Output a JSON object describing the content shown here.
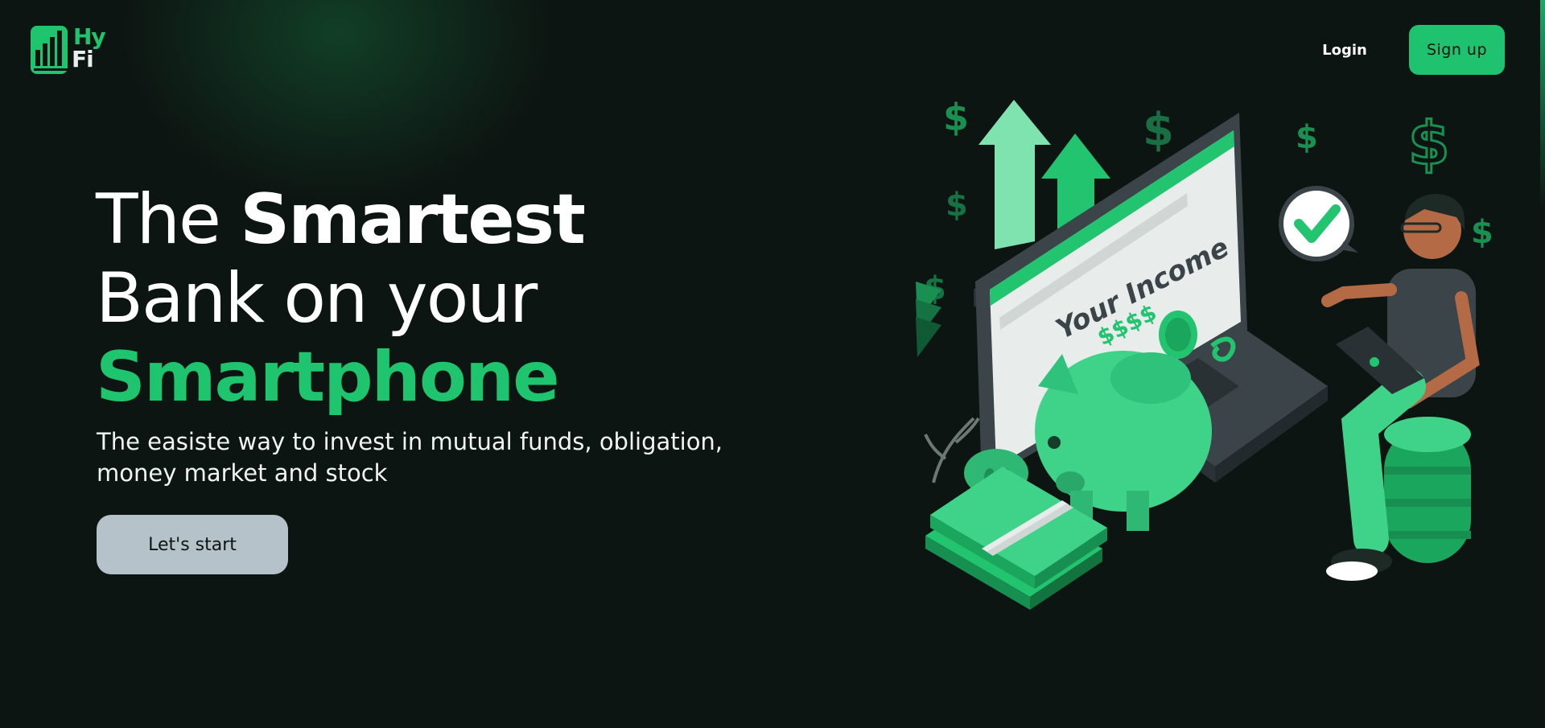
{
  "brand": {
    "logo_top": "Hy",
    "logo_bottom": "Fi",
    "primary_color": "#1ec26f",
    "logo_icon": "bar-chart-icon"
  },
  "nav": {
    "login_label": "Login",
    "signup_label": "Sign up"
  },
  "hero": {
    "title_word_1": "The",
    "title_word_2": "Smartest",
    "title_line_2": "Bank on your",
    "title_line_3": "Smartphone",
    "subtitle": "The easiste way to invest in mutual funds, obligation, money market and stock",
    "cta_label": "Let's start"
  },
  "illustration": {
    "screen_heading": "Your Income",
    "screen_amount": "$$$$",
    "dollar_sign": "$"
  },
  "colors": {
    "background": "#0d1512",
    "accent_green": "#1fc46f",
    "cta_background": "#b6c2c9"
  }
}
